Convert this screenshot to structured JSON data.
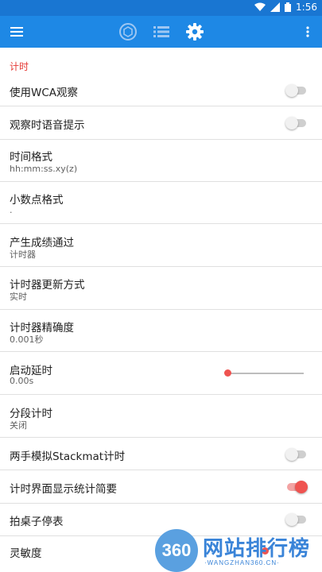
{
  "status_bar": {
    "time": "1:56",
    "wifi_icon": "wifi-icon",
    "battery_icon": "battery-icon"
  },
  "toolbar": {
    "menu_icon": "menu-icon",
    "tabs": [
      "cube-icon",
      "list-icon",
      "gear-icon"
    ],
    "overflow_icon": "overflow-icon",
    "background": "#1e88e5"
  },
  "section": {
    "title": "计时"
  },
  "settings": [
    {
      "title": "使用WCA观察",
      "control": "switch",
      "checked": false
    },
    {
      "title": "观察时语音提示",
      "control": "switch",
      "checked": false
    },
    {
      "title": "时间格式",
      "subtitle": "hh:mm:ss.xy(z)"
    },
    {
      "title": "小数点格式",
      "subtitle": "."
    },
    {
      "title": "产生成绩通过",
      "subtitle": "计时器"
    },
    {
      "title": "计时器更新方式",
      "subtitle": "实时"
    },
    {
      "title": "计时器精确度",
      "subtitle": "0.001秒"
    },
    {
      "title": "启动延时",
      "subtitle": "0.00s",
      "control": "slider",
      "value": 0
    },
    {
      "title": "分段计时",
      "subtitle": "关闭"
    },
    {
      "title": "两手模拟Stackmat计时",
      "control": "switch",
      "checked": false
    },
    {
      "title": "计时界面显示统计简要",
      "control": "switch",
      "checked": true
    },
    {
      "title": "拍桌子停表",
      "control": "switch",
      "checked": false
    },
    {
      "title": "灵敏度",
      "control": "slider"
    }
  ],
  "watermark": {
    "logo_text": "360",
    "brand": "网站排行榜",
    "url": "·WANGZHAN360.CN·"
  },
  "colors": {
    "accent": "#ef5350",
    "section_header": "#e53935",
    "primary": "#1e88e5"
  }
}
